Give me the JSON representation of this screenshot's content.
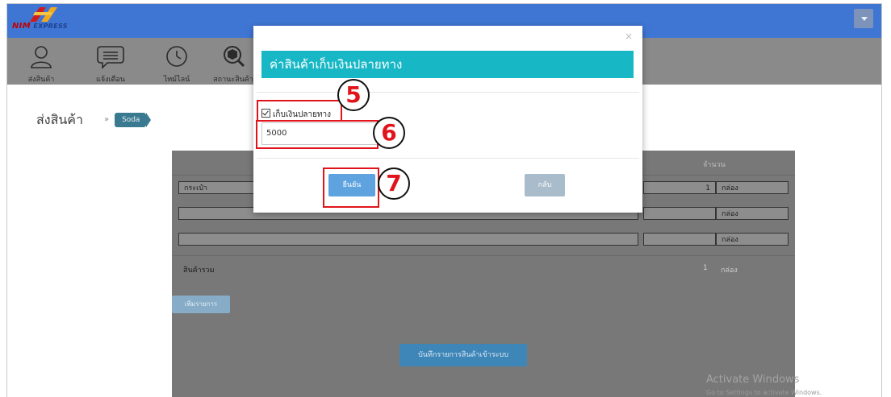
{
  "header": {
    "logo_word": "NIM",
    "logo_word2": "EXPRESS",
    "menu_icon": "chevron-down-icon"
  },
  "nav": {
    "items": [
      {
        "label": "ส่งสินค้า",
        "icon": "user-icon"
      },
      {
        "label": "แจ้งเตือน",
        "icon": "message-icon"
      },
      {
        "label": "ไทม์ไลน์",
        "icon": "clock-icon"
      },
      {
        "label": "สถานะสินค้า",
        "icon": "package-search-icon"
      }
    ]
  },
  "breadcrumb": {
    "title": "ส่งสินค้า",
    "separator": "»",
    "tag": "Soda"
  },
  "table": {
    "qty_header": "จำนวน",
    "rows": [
      {
        "item": "กระเป๋า",
        "qty": "1",
        "unit": "กล่อง"
      },
      {
        "item": "",
        "qty": "",
        "unit": "กล่อง"
      },
      {
        "item": "",
        "qty": "",
        "unit": "กล่อง"
      }
    ],
    "total_label": "สินค้ารวม",
    "total_qty": "1",
    "total_unit": "กล่อง"
  },
  "buttons": {
    "add_item": "เพิ่มรายการ",
    "save": "บันทึกรายการสินค้าเข้าระบบ"
  },
  "modal": {
    "title": "ค่าสินค้าเก็บเงินปลายทาง",
    "close": "×",
    "cod_label": "เก็บเงินปลายทาง",
    "cod_checked": true,
    "amount": "5000",
    "confirm": "ยืนยัน",
    "back": "กลับ"
  },
  "annotations": {
    "step5": "5",
    "step6": "6",
    "step7": "7",
    "color": "#e0141a"
  },
  "watermark": {
    "line1": "Activate Windows",
    "line2": "Go to Settings to activate Windows."
  },
  "colors": {
    "topbar": "#3f76d4",
    "modal_title_bg": "#17b7c5",
    "confirm_bg": "#5ea3e0",
    "back_bg": "#a8bccb"
  }
}
